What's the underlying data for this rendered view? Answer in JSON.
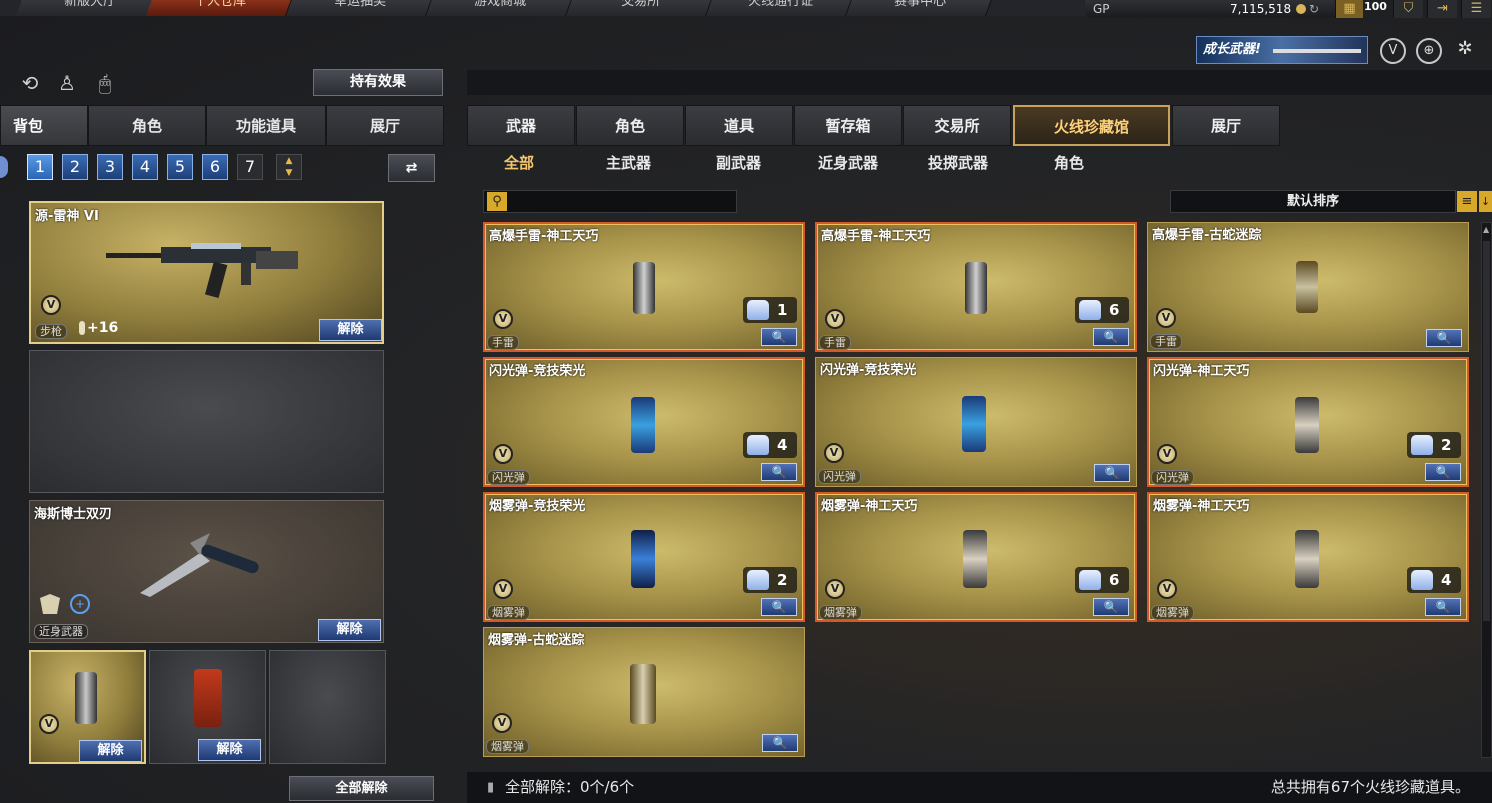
{
  "topnav": {
    "tabs": [
      "新版大厅",
      "个人仓库",
      "幸运抽奖",
      "游戏商城",
      "交易所",
      "火线通行证",
      "赛事中心"
    ],
    "currency_label": "GP",
    "currency_value": "7,115,518",
    "level_value": "100"
  },
  "promo": {
    "label": "成长武器!"
  },
  "left": {
    "effects_button": "持有效果",
    "tabs": [
      "背包",
      "角色",
      "功能道具",
      "展厅"
    ],
    "pages": [
      "1",
      "2",
      "3",
      "4",
      "5",
      "6",
      "7"
    ],
    "slots": {
      "primary": {
        "name": "源-雷神 VI",
        "type": "步枪",
        "ammo": "+16",
        "badge": "V",
        "action": "解除"
      },
      "melee": {
        "name": "海斯博士双刃",
        "type": "近身武器",
        "action": "解除"
      },
      "small1": {
        "badge": "V",
        "action": "解除"
      },
      "small2": {
        "action": "解除"
      }
    },
    "unequip_all": "全部解除"
  },
  "right": {
    "tabs": [
      "武器",
      "角色",
      "道具",
      "暂存箱",
      "交易所",
      "火线珍藏馆",
      "展厅"
    ],
    "subtabs": [
      "全部",
      "主武器",
      "副武器",
      "近身武器",
      "投掷武器",
      "角色"
    ],
    "sort_label": "默认排序",
    "cards": [
      {
        "name": "高爆手雷-神工天巧",
        "type": "手雷",
        "count": "1",
        "badge": "V"
      },
      {
        "name": "高爆手雷-神工天巧",
        "type": "手雷",
        "count": "6",
        "badge": "V"
      },
      {
        "name": "高爆手雷-古蛇迷踪",
        "type": "手雷",
        "count": "",
        "badge": "V"
      },
      {
        "name": "闪光弹-竞技荣光",
        "type": "闪光弹",
        "count": "4",
        "badge": "V"
      },
      {
        "name": "闪光弹-竞技荣光",
        "type": "闪光弹",
        "count": "",
        "badge": "V"
      },
      {
        "name": "闪光弹-神工天巧",
        "type": "闪光弹",
        "count": "2",
        "badge": "V"
      },
      {
        "name": "烟雾弹-竞技荣光",
        "type": "烟雾弹",
        "count": "2",
        "badge": "V"
      },
      {
        "name": "烟雾弹-神工天巧",
        "type": "烟雾弹",
        "count": "6",
        "badge": "V"
      },
      {
        "name": "烟雾弹-神工天巧",
        "type": "烟雾弹",
        "count": "4",
        "badge": "V"
      },
      {
        "name": "烟雾弹-古蛇迷踪",
        "type": "烟雾弹",
        "count": "",
        "badge": "V"
      }
    ],
    "footer_left": "全部解除：0个/6个",
    "footer_right": "总共拥有67个火线珍藏道具。"
  },
  "colors": {
    "accent_gold": "#f5c76a",
    "highlight_border": "#d25a28",
    "button_blue": "#2a64b6"
  }
}
